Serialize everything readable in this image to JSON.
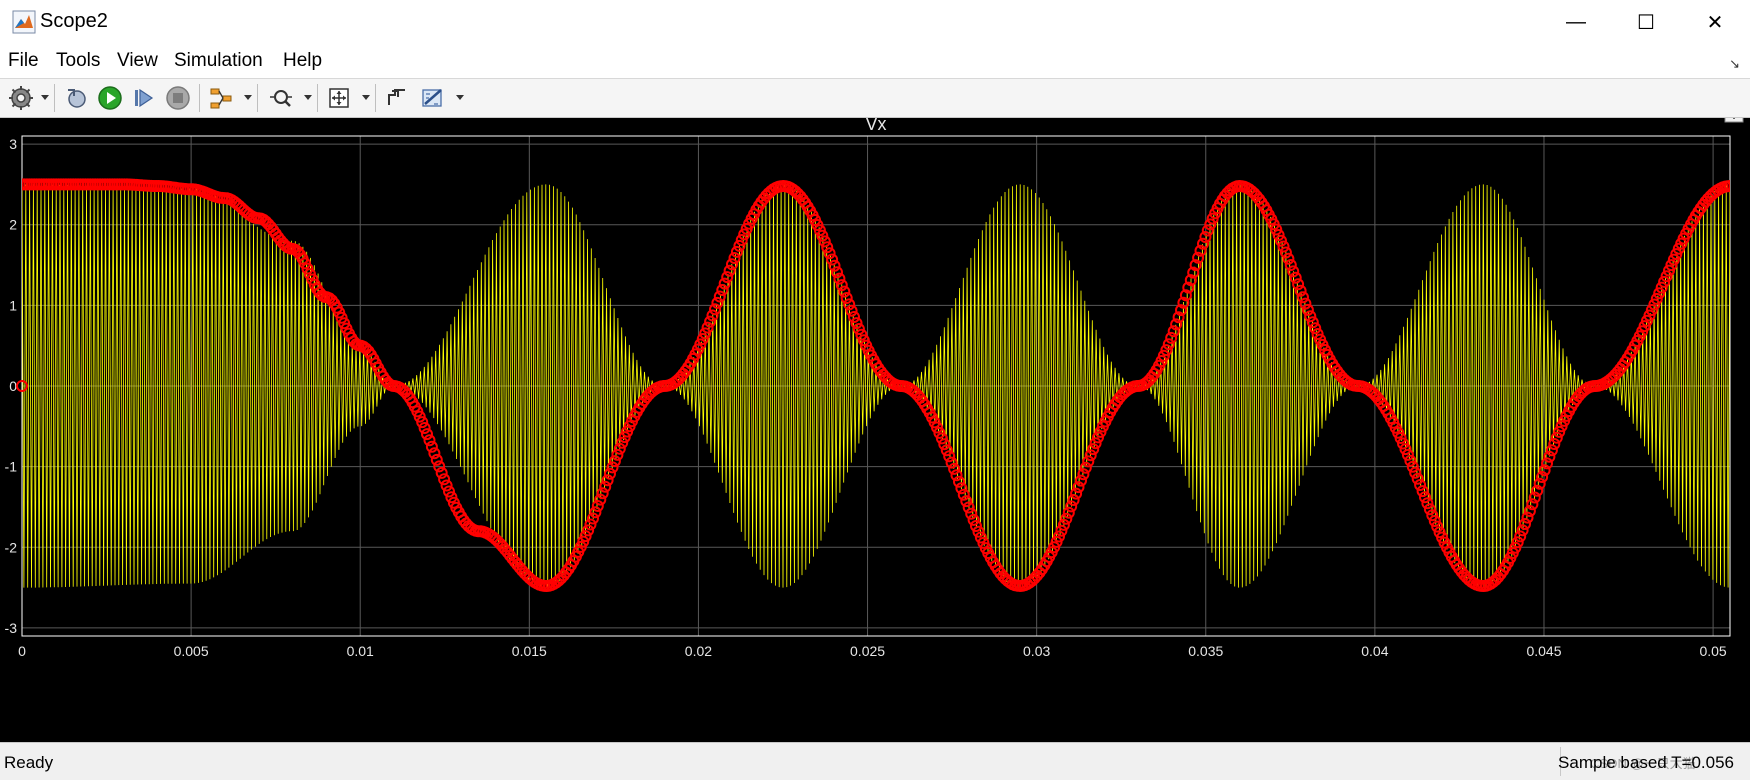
{
  "window": {
    "title": "Scope2"
  },
  "window_controls": {
    "minimize": "—",
    "maximize": "☐",
    "close": "✕"
  },
  "menu": [
    "File",
    "Tools",
    "View",
    "Simulation",
    "Help"
  ],
  "toolbar": {
    "items": [
      "settings-icon",
      "step-back-icon",
      "run-icon",
      "step-forward-icon",
      "stop-icon",
      "signal-selection-icon",
      "zoom-icon",
      "autoscale-icon",
      "highlight-icon",
      "measurements-icon"
    ]
  },
  "status": {
    "left": "Ready",
    "right": "Sample based   T=0.056",
    "watermark": "CSDN @一只大猫"
  },
  "colors": {
    "plot_background": "#000000",
    "axes_frame": "#ffffff",
    "grid": "#595959",
    "series_envelope": "#ffff00",
    "series_markers": "#ff0000",
    "text_axes": "#e6e6e6"
  },
  "chart_data": {
    "type": "line",
    "title": "Vx",
    "xlabel": "",
    "ylabel": "",
    "xlim": [
      0,
      0.0505
    ],
    "ylim": [
      -3.1,
      3.1
    ],
    "xticks": [
      0,
      0.005,
      0.01,
      0.015,
      0.02,
      0.025,
      0.03,
      0.035,
      0.04,
      0.045,
      0.05
    ],
    "xtick_labels": [
      "0",
      "0.005",
      "0.01",
      "0.015",
      "0.02",
      "0.025",
      "0.03",
      "0.035",
      "0.04",
      "0.045",
      "0.05"
    ],
    "yticks": [
      -3,
      -2,
      -1,
      0,
      1,
      2,
      3
    ],
    "ytick_labels": [
      "-3",
      "-2",
      "-1",
      "0",
      "1",
      "2",
      "3"
    ],
    "grid": true,
    "series": [
      {
        "style": "yellow high-frequency oscillation (envelope shown)",
        "amplitude_envelope": {
          "x": [
            0,
            0.005,
            0.008,
            0.01,
            0.011,
            0.0155,
            0.019,
            0.0225,
            0.026,
            0.0295,
            0.033,
            0.036,
            0.0395,
            0.0432,
            0.0465,
            0.0505
          ],
          "y": [
            2.5,
            2.45,
            1.8,
            0.5,
            0.0,
            2.5,
            0.0,
            2.5,
            0.0,
            2.5,
            0.0,
            2.5,
            0.0,
            2.5,
            0.0,
            2.5
          ]
        }
      },
      {
        "style": "red circle markers",
        "x": [
          0,
          0.001,
          0.002,
          0.003,
          0.004,
          0.005,
          0.006,
          0.007,
          0.008,
          0.009,
          0.01,
          0.011,
          0.0135,
          0.0155,
          0.019,
          0.0225,
          0.026,
          0.0295,
          0.033,
          0.036,
          0.0395,
          0.0432,
          0.0465,
          0.0505
        ],
        "y": [
          2.5,
          2.5,
          2.5,
          2.5,
          2.48,
          2.44,
          2.33,
          2.08,
          1.7,
          1.1,
          0.5,
          0.0,
          -1.8,
          -2.48,
          0.0,
          2.48,
          0.0,
          -2.48,
          0.0,
          2.48,
          0.0,
          -2.48,
          0.0,
          2.48
        ]
      }
    ]
  }
}
